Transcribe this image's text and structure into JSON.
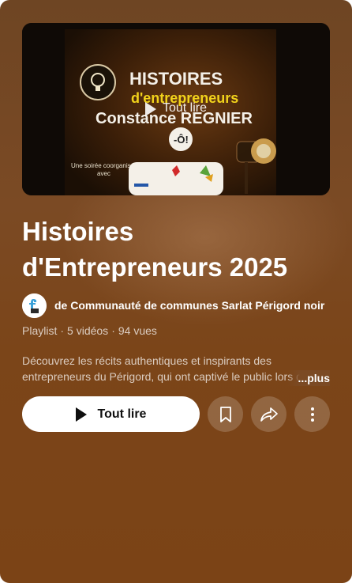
{
  "thumbnail": {
    "headline_1": "HISTOIRES",
    "headline_2": "d'entrepreneurs",
    "headline_3": "Constance REGNIER",
    "cohost_line_1": "Une soirée coorganisée",
    "cohost_line_2": "avec",
    "overlay_label": "Tout lire"
  },
  "playlist": {
    "title_line_1": "Histoires",
    "title_line_2": "d'Entrepreneurs 2025",
    "owner": "de Communauté de communes Sarlat Périgord noir",
    "meta_type": "Playlist",
    "meta_videos": "5 vidéos",
    "meta_views": "94 vues",
    "description": "Découvrez les récits authentiques et inspirants des entrepreneurs du Périgord, qui ont captivé le public lors de ces soirées.",
    "more_label": "...plus"
  },
  "actions": {
    "play_all": "Tout lire"
  },
  "icons": {
    "play": "play-icon",
    "save": "bookmark-icon",
    "share": "share-icon",
    "more": "more-vertical-icon"
  },
  "colors": {
    "background": "#7b4a24",
    "thumb_title_yellow": "#f2d31b"
  }
}
